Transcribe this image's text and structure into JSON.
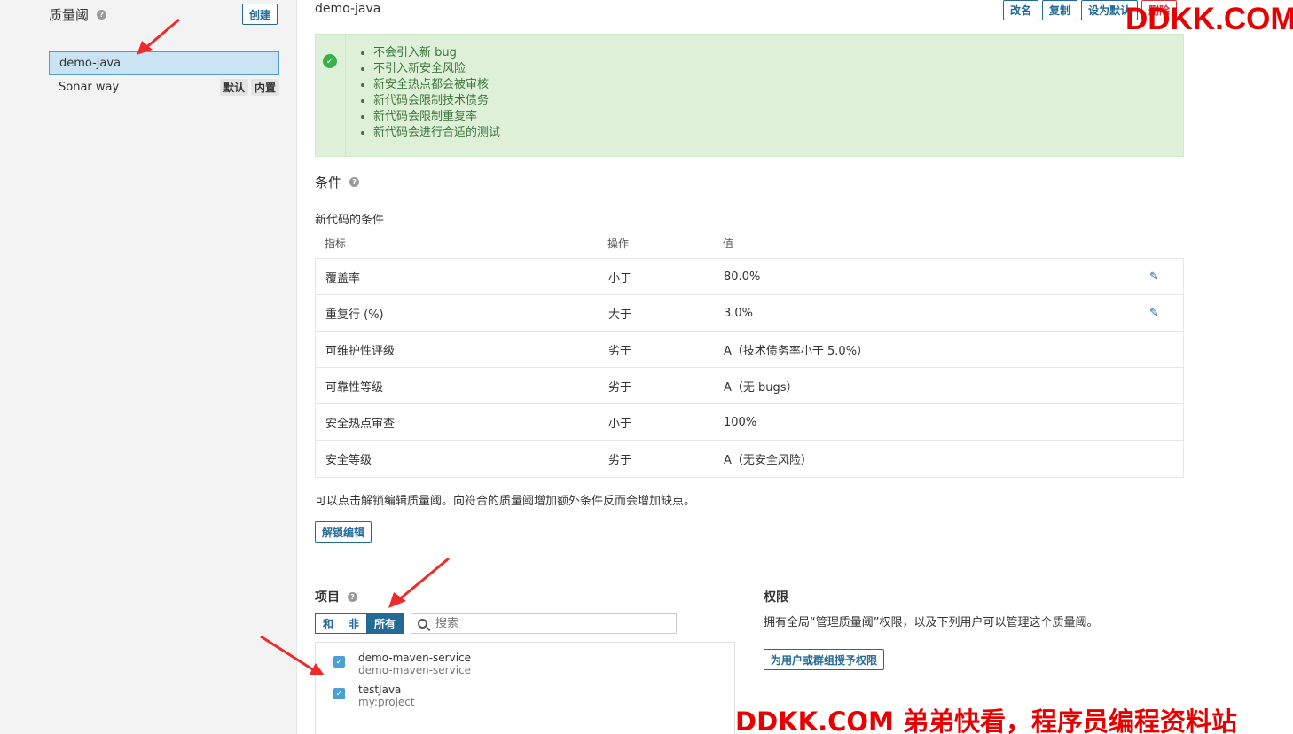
{
  "sidebar": {
    "title": "质量阈",
    "create_label": "创建",
    "items": [
      {
        "name": "demo-java",
        "badges": []
      },
      {
        "name": "Sonar way",
        "badges": [
          "默认",
          "内置"
        ]
      }
    ]
  },
  "gate": {
    "name": "demo-java",
    "actions": {
      "rename": "改名",
      "copy": "复制",
      "set_default": "设为默认",
      "delete": "删除"
    }
  },
  "info": {
    "items": [
      "不会引入新 bug",
      "不引入新安全风险",
      "新安全热点都会被审核",
      "新代码会限制技术债务",
      "新代码会限制重复率",
      "新代码会进行合适的测试"
    ]
  },
  "conditions": {
    "title": "条件",
    "subtitle": "新代码的条件",
    "headers": {
      "metric": "指标",
      "op": "操作",
      "value": "值"
    },
    "rows": [
      {
        "metric": "覆盖率",
        "op": "小于",
        "value": "80.0%"
      },
      {
        "metric": "重复行 (%)",
        "op": "大于",
        "value": "3.0%"
      },
      {
        "metric": "可维护性评级",
        "op": "劣于",
        "value": "A（技术债务率小于 5.0%）"
      },
      {
        "metric": "可靠性等级",
        "op": "劣于",
        "value": "A（无 bugs）"
      },
      {
        "metric": "安全热点审查",
        "op": "小于",
        "value": "100%"
      },
      {
        "metric": "安全等级",
        "op": "劣于",
        "value": "A（无安全风险）"
      }
    ],
    "note": "可以点击解锁编辑质量阈。向符合的质量阈增加额外条件反而会增加缺点。",
    "unlock_label": "解锁编辑"
  },
  "projects": {
    "title": "项目",
    "filters": [
      "和",
      "非",
      "所有"
    ],
    "search_placeholder": "搜索",
    "items": [
      {
        "name": "demo-maven-service",
        "key": "demo-maven-service"
      },
      {
        "name": "testJava",
        "key": "my:project"
      }
    ]
  },
  "permissions": {
    "title": "权限",
    "desc": "拥有全局“管理质量阈”权限，以及下列用户可以管理这个质量阈。",
    "grant_label": "为用户或群组授予权限"
  },
  "watermark": {
    "top": "DDKK.COM",
    "bottom": "DDKK.COM 弟弟快看，程序员编程资料站"
  },
  "colors": {
    "accent": "#236a97",
    "success_bg": "#dff0d8",
    "watermark": "#e80000",
    "arrow": "#ee2b2b"
  }
}
